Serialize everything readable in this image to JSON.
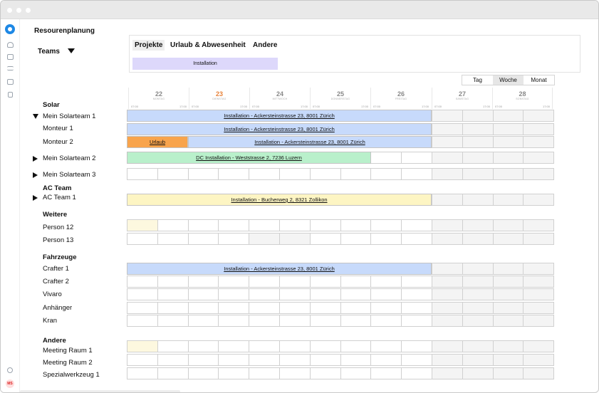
{
  "app": {
    "title": "Resourenplanung",
    "teams_label": "Teams",
    "user_initials": "MS"
  },
  "sidebar": {
    "icons": [
      "home-icon",
      "inbox-icon",
      "transfer-icon",
      "calendar-icon",
      "mobile-icon"
    ],
    "settings_icon": "gear-icon"
  },
  "legend": {
    "tabs": [
      {
        "label": "Projekte",
        "active": true
      },
      {
        "label": "Urlaub & Abwesenheit",
        "active": false
      },
      {
        "label": "Andere",
        "active": false
      }
    ],
    "chip": "Installation"
  },
  "view_switch": {
    "options": [
      "Tag",
      "Woche",
      "Monat"
    ],
    "selected": "Woche"
  },
  "days": [
    {
      "num": "22",
      "name": "MONTAG",
      "start": "07:00",
      "end": "17:00"
    },
    {
      "num": "23",
      "name": "DIENSTAG",
      "start": "07:00",
      "end": "17:00",
      "today": true
    },
    {
      "num": "24",
      "name": "MITTWOCH",
      "start": "07:00",
      "end": "17:00"
    },
    {
      "num": "25",
      "name": "DONNERSTAG",
      "start": "07:00",
      "end": "17:00"
    },
    {
      "num": "26",
      "name": "FREITAG",
      "start": "07:00",
      "end": "17:00"
    },
    {
      "num": "27",
      "name": "SAMSTAG",
      "start": "07:00",
      "end": "17:00"
    },
    {
      "num": "28",
      "name": "SONNTAG",
      "start": "07:00",
      "end": "17:00"
    }
  ],
  "groups": {
    "solar": "Solar",
    "ac": "AC Team",
    "weitere": "Weitere",
    "fahrzeuge": "Fahrzeuge",
    "andere": "Andere"
  },
  "rows": {
    "mein_solarteam_1": "Mein Solarteam 1",
    "monteur_1": "Monteur 1",
    "monteur_2": "Monteur 2",
    "mein_solarteam_2": "Mein Solarteam 2",
    "mein_solarteam_3": "Mein Solarteam 3",
    "ac_team_1": "AC Team 1",
    "person_12": "Person 12",
    "person_13": "Person 13",
    "crafter_1": "Crafter 1",
    "crafter_2": "Crafter 2",
    "vivaro": "Vivaro",
    "anhaenger": "Anhänger",
    "kran": "Kran",
    "meeting_raum_1": "Meeting Raum 1",
    "meeting_raum_2": "Meeting Raum 2",
    "spezialwerkzeug_1": "Spezialwerkzeug 1"
  },
  "events": {
    "team1": "Installation - Ackersteinstrasse 23, 8001 Zürich",
    "monteur1": "Installation - Ackersteinstrasse 23, 8001 Zürich",
    "monteur2_urlaub": "Urlaub",
    "monteur2": "Installation - Ackersteinstrasse 23, 8001 Zürich",
    "team2": "DC Installation - Weststrasse 2, 7236 Luzern",
    "ac_team1": "Installation - Bucherweg 2, 8321 Zollikon",
    "crafter1": "Installation - Ackersteinstrasse 23, 8001 Zürich"
  },
  "colors": {
    "accent": "#1e88e5",
    "installation": "#c7dafb",
    "dc_installation": "#b9f0cb",
    "ac_installation": "#fdf5c3",
    "urlaub": "#f8a44c",
    "legend_chip": "#ddd8fb",
    "today": "#e8823a"
  }
}
